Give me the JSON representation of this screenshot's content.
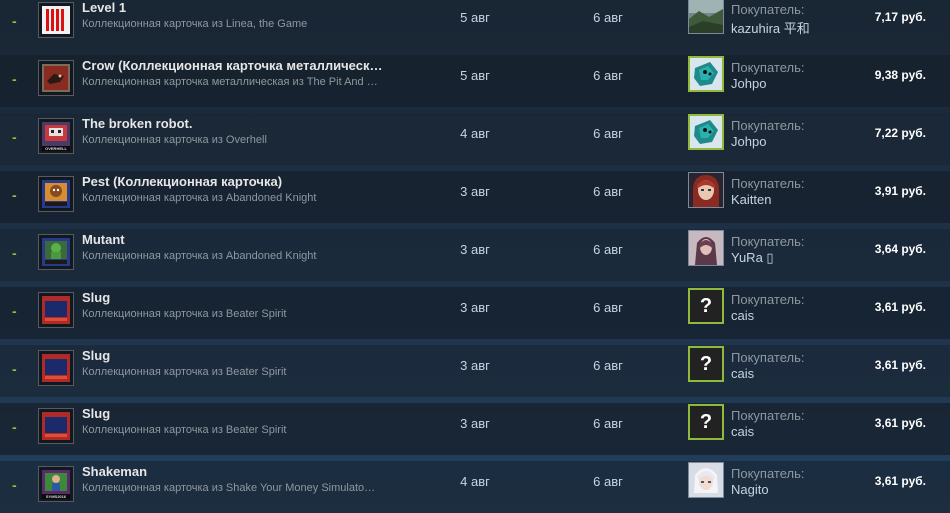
{
  "listing_history": [
    {
      "result": "-",
      "item_name": "Level 1",
      "game_name": "Коллекционная карточка из Linea, the Game",
      "listed_date": "5 авг",
      "acted_date": "6 авг",
      "buyer_label": "Покупатель:",
      "buyer_name": "kazuhira 平和",
      "price": "7,17 руб.",
      "thumb_icon": "red-stripes-card-icon",
      "avatar_icon": "landscape-avatar-icon"
    },
    {
      "result": "-",
      "item_name": "Crow (Коллекционная карточка металлическ…",
      "game_name": "Коллекционная карточка металлическая из The Pit And …",
      "listed_date": "5 авг",
      "acted_date": "6 авг",
      "buyer_label": "Покупатель:",
      "buyer_name": "Johpo",
      "price": "9,38 руб.",
      "thumb_icon": "crow-card-icon",
      "avatar_icon": "teal-creature-avatar-icon"
    },
    {
      "result": "-",
      "item_name": "The broken robot.",
      "game_name": "Коллекционная карточка из Overhell",
      "listed_date": "4 авг",
      "acted_date": "6 авг",
      "buyer_label": "Покупатель:",
      "buyer_name": "Johpo",
      "price": "7,22 руб.",
      "thumb_icon": "robot-card-icon",
      "thumb_strip": "OVERHELL",
      "avatar_icon": "teal-creature-avatar-icon"
    },
    {
      "result": "-",
      "item_name": "Pest (Коллекционная карточка)",
      "game_name": "Коллекционная карточка из Abandoned Knight",
      "listed_date": "3 авг",
      "acted_date": "6 авг",
      "buyer_label": "Покупатель:",
      "buyer_name": "Kaitten",
      "price": "3,91 руб.",
      "thumb_icon": "pest-card-icon",
      "avatar_icon": "red-hair-girl-avatar-icon"
    },
    {
      "result": "-",
      "item_name": "Mutant",
      "game_name": "Коллекционная карточка из Abandoned Knight",
      "listed_date": "3 авг",
      "acted_date": "6 авг",
      "buyer_label": "Покупатель:",
      "buyer_name": "YuRa ▯",
      "price": "3,64 руб.",
      "thumb_icon": "mutant-card-icon",
      "avatar_icon": "dark-girl-avatar-icon"
    },
    {
      "result": "-",
      "item_name": "Slug",
      "game_name": "Коллекционная карточка из Beater Spirit",
      "listed_date": "3 авг",
      "acted_date": "6 авг",
      "buyer_label": "Покупатель:",
      "buyer_name": "cais",
      "price": "3,61 руб.",
      "thumb_icon": "slug-card-icon",
      "avatar_icon": "question-mark-avatar-icon",
      "avatar_glyph": "?"
    },
    {
      "result": "-",
      "item_name": "Slug",
      "game_name": "Коллекционная карточка из Beater Spirit",
      "listed_date": "3 авг",
      "acted_date": "6 авг",
      "buyer_label": "Покупатель:",
      "buyer_name": "cais",
      "price": "3,61 руб.",
      "thumb_icon": "slug-card-icon",
      "avatar_icon": "question-mark-avatar-icon",
      "avatar_glyph": "?"
    },
    {
      "result": "-",
      "item_name": "Slug",
      "game_name": "Коллекционная карточка из Beater Spirit",
      "listed_date": "3 авг",
      "acted_date": "6 авг",
      "buyer_label": "Покупатель:",
      "buyer_name": "cais",
      "price": "3,61 руб.",
      "thumb_icon": "slug-card-icon",
      "avatar_icon": "question-mark-avatar-icon",
      "avatar_glyph": "?"
    },
    {
      "result": "-",
      "item_name": "Shakeman",
      "game_name": "Коллекционная карточка из Shake Your Money Simulato…",
      "listed_date": "4 авг",
      "acted_date": "6 авг",
      "buyer_label": "Покупатель:",
      "buyer_name": "Nagito",
      "price": "3,61 руб.",
      "thumb_icon": "shakeman-card-icon",
      "thumb_strip": "SYMS2016",
      "avatar_icon": "white-hair-avatar-icon"
    }
  ],
  "colors": {
    "background": "#1b2838",
    "result_dash": "#8bc53f",
    "item_name": "#e6e6e6",
    "game_name": "#8f98a0",
    "avatar_border_green": "#90ba3c",
    "price": "#ffffff"
  }
}
